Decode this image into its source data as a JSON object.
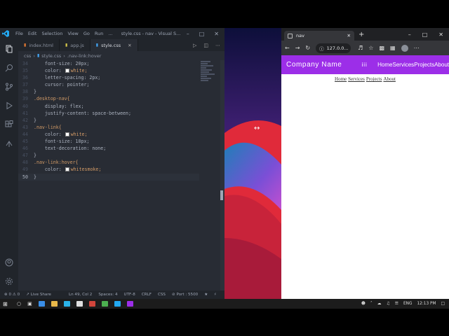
{
  "vscode": {
    "menu": [
      "File",
      "Edit",
      "Selection",
      "View",
      "Go",
      "Run",
      "..."
    ],
    "window_title": "style.css - nav - Visual S...",
    "tabs": [
      {
        "label": "index.html",
        "type": "html"
      },
      {
        "label": "app.js",
        "type": "js"
      },
      {
        "label": "style.css",
        "type": "css",
        "active": true
      }
    ],
    "breadcrumb": {
      "folder": "css",
      "file": "style.css",
      "symbol": ".nav-link:hover"
    },
    "code": [
      {
        "n": "34",
        "text": "    font-size: 20px;"
      },
      {
        "n": "35",
        "text": "    color: white;",
        "swatch": "#ffffff"
      },
      {
        "n": "36",
        "text": "    letter-spacing: 2px;"
      },
      {
        "n": "37",
        "text": "    cursor: pointer;"
      },
      {
        "n": "38",
        "text": "}"
      },
      {
        "n": "39",
        "text": ".desktop-nav{"
      },
      {
        "n": "40",
        "text": "    display: flex;"
      },
      {
        "n": "41",
        "text": "    justify-content: space-between;"
      },
      {
        "n": "42",
        "text": "}"
      },
      {
        "n": "43",
        "text": ".nav-link{"
      },
      {
        "n": "44",
        "text": "    color: white;",
        "swatch": "#ffffff"
      },
      {
        "n": "45",
        "text": "    font-size: 18px;"
      },
      {
        "n": "46",
        "text": "    text-decoration: none;"
      },
      {
        "n": "47",
        "text": "}"
      },
      {
        "n": "48",
        "text": ".nav-link:hover{"
      },
      {
        "n": "49",
        "text": "    color: whitesmoke;",
        "swatch": "#f5f5f5"
      },
      {
        "n": "50",
        "text": "}",
        "current": true
      }
    ],
    "status": {
      "errors": "0",
      "warnings": "0",
      "live_share": "Live Share",
      "position": "Ln 49, Col 2",
      "spaces": "Spaces: 4",
      "encoding": "UTF-8",
      "eol": "CRLF",
      "language": "CSS",
      "port": "Port : 5500"
    }
  },
  "browser": {
    "tab_title": "nav",
    "url": "127.0.0...",
    "site": {
      "brand": "Company Name",
      "burger": "iii",
      "nav_links": [
        "Home",
        "Services",
        "Projects",
        "About"
      ],
      "page_links": [
        "Home",
        "Services",
        "Projects",
        "About"
      ],
      "nav_color": "#9c2ee8"
    }
  },
  "taskbar": {
    "language": "ENG",
    "time": "12:13 PM"
  },
  "colors": {
    "editor_bg": "#282c34",
    "accent_purple": "#9c2ee8"
  }
}
